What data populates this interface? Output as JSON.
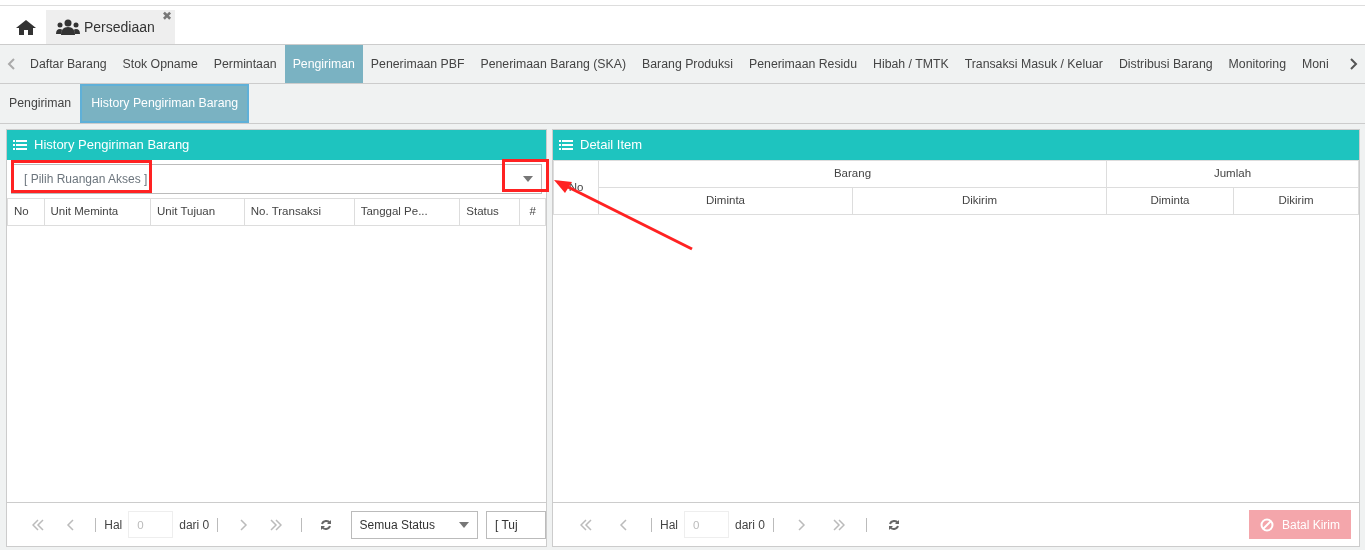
{
  "app_tabs": [
    {
      "label": "Persediaan",
      "selected": true,
      "close_glyph": "✖"
    }
  ],
  "menu": {
    "items": [
      {
        "label": "Daftar Barang",
        "selected": false
      },
      {
        "label": "Stok Opname",
        "selected": false
      },
      {
        "label": "Permintaan",
        "selected": false
      },
      {
        "label": "Pengiriman",
        "selected": true
      },
      {
        "label": "Penerimaan PBF",
        "selected": false
      },
      {
        "label": "Penerimaan Barang (SKA)",
        "selected": false
      },
      {
        "label": "Barang Produksi",
        "selected": false
      },
      {
        "label": "Penerimaan Residu",
        "selected": false
      },
      {
        "label": "Hibah / TMTK",
        "selected": false
      },
      {
        "label": "Transaksi Masuk / Keluar",
        "selected": false
      },
      {
        "label": "Distribusi Barang",
        "selected": false
      },
      {
        "label": "Monitoring",
        "selected": false
      },
      {
        "label": "Moni",
        "selected": false
      }
    ]
  },
  "sub_tabs": [
    {
      "label": "Pengiriman",
      "selected": false
    },
    {
      "label": "History Pengiriman Barang",
      "selected": true
    }
  ],
  "left_panel": {
    "title": "History Pengiriman Barang",
    "room_select": {
      "placeholder": "[ Pilih Ruangan Akses ]"
    },
    "columns": [
      "No",
      "Unit Meminta",
      "Unit Tujuan",
      "No. Transaksi",
      "Tanggal Pe...",
      "Status",
      "#"
    ],
    "pager": {
      "page_label": "Hal",
      "page": "0",
      "of": "dari 0",
      "status_select": "Semua Status",
      "tujuan_select": "[ Tuj"
    }
  },
  "right_panel": {
    "title": "Detail Item",
    "columns_top": [
      "No",
      "Barang",
      "Jumlah"
    ],
    "columns_sub": [
      "Diminta",
      "Dikirim",
      "Diminta",
      "Dikirim"
    ],
    "pager": {
      "page_label": "Hal",
      "page": "0",
      "of": "dari 0"
    },
    "cancel_button": {
      "label": "Batal Kirim",
      "disabled": true
    }
  }
}
